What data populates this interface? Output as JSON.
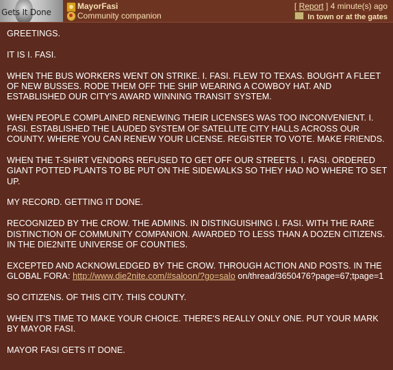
{
  "post": {
    "avatar_caption": "Gets It Done",
    "username": "MayorFasi",
    "user_title": "Community companion",
    "report_label": "Report",
    "timestamp": "4 minute(s) ago",
    "location": "In town or at the gates",
    "icons": {
      "hero": "hero-badge-icon",
      "companion": "community-companion-icon",
      "town": "town-gates-icon"
    },
    "paragraphs": [
      "GREETINGS.",
      "IT IS I. FASI.",
      "WHEN THE BUS WORKERS WENT ON STRIKE. I. FASI. FLEW TO TEXAS. BOUGHT A FLEET OF NEW BUSSES. RODE THEM OFF THE SHIP WEARING A COWBOY HAT. AND ESTABLISHED OUR CITY'S AWARD WINNING TRANSIT SYSTEM.",
      "WHEN PEOPLE COMPLAINED RENEWING THEIR LICENSES WAS TOO INCONVENIENT. I. FASI. ESTABLISHED THE LAUDED SYSTEM OF SATELLITE CITY HALLS ACROSS OUR COUNTY. WHERE YOU CAN RENEW YOUR LICENSE. REGISTER TO VOTE. MAKE FRIENDS.",
      "WHEN THE T-SHIRT VENDORS REFUSED TO GET OFF OUR STREETS. I. FASI. ORDERED GIANT POTTED PLANTS TO BE PUT ON THE SIDEWALKS SO THEY HAD NO WHERE TO SET UP.",
      "MY RECORD. GETTING IT DONE.",
      "RECOGNIZED BY THE CROW. THE ADMINS. IN DISTINGUISHING I. FASI. WITH THE RARE DISTINCTION OF COMMUNITY COMPANION. AWARDED TO LESS THAN A DOZEN CITIZENS. IN THE DIE2NITE UNIVERSE OF COUNTIES."
    ],
    "link_paragraph": {
      "before": "EXCEPTED AND ACKNOWLEDGED BY THE CROW. THROUGH ACTION AND POSTS. IN THE GLOBAL FORA: ",
      "link": "http://www.die2nite.com/#saloon/?go=salo",
      "after": " on/thread/3650476?page=67;tpage=1"
    },
    "closing_paragraphs": [
      "SO CITIZENS. OF THIS CITY. THIS COUNTY.",
      "WHEN IT'S TIME TO MAKE YOUR CHOICE. THERE'S REALLY ONLY ONE. PUT YOUR MARK BY MAYOR FASI.",
      "MAYOR FASI GETS IT DONE."
    ]
  }
}
